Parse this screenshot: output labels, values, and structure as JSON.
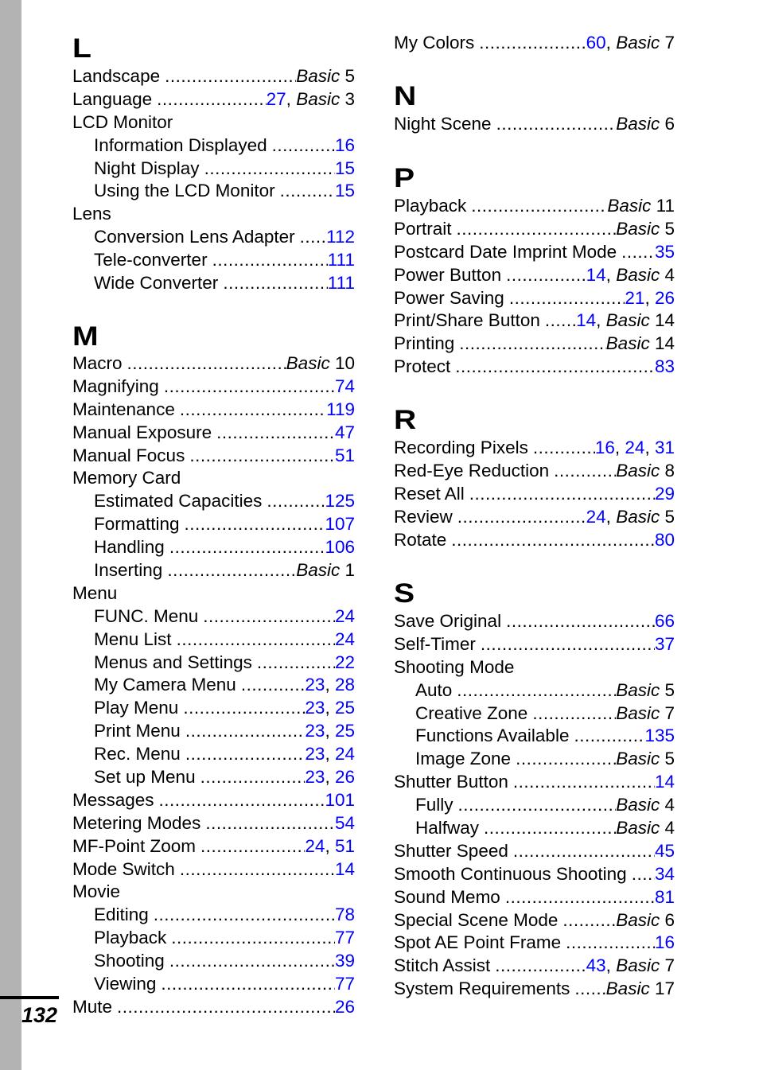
{
  "page_number": "132",
  "colors": {
    "link": "#0000ff",
    "sidebar": "#b3b3b3"
  },
  "columns": [
    {
      "sections": [
        {
          "letter": "L",
          "entries": [
            {
              "term": "Landscape",
              "refs": [
                {
                  "basic": "Basic",
                  "page": "5"
                }
              ]
            },
            {
              "term": "Language",
              "refs": [
                {
                  "link": "27"
                },
                {
                  "basic": "Basic",
                  "page": "3"
                }
              ]
            },
            {
              "term": "LCD Monitor",
              "head": true
            },
            {
              "term": "Information Displayed",
              "sub": true,
              "refs": [
                {
                  "link": "16"
                }
              ]
            },
            {
              "term": "Night Display",
              "sub": true,
              "refs": [
                {
                  "link": "15"
                }
              ]
            },
            {
              "term": "Using the LCD Monitor",
              "sub": true,
              "refs": [
                {
                  "link": "15"
                }
              ]
            },
            {
              "term": "Lens",
              "head": true
            },
            {
              "term": "Conversion Lens Adapter",
              "sub": true,
              "refs": [
                {
                  "link": "112"
                }
              ]
            },
            {
              "term": "Tele-converter",
              "sub": true,
              "refs": [
                {
                  "link": "111"
                }
              ]
            },
            {
              "term": "Wide Converter",
              "sub": true,
              "refs": [
                {
                  "link": "111"
                }
              ]
            }
          ]
        },
        {
          "letter": "M",
          "entries": [
            {
              "term": "Macro",
              "refs": [
                {
                  "basic": "Basic",
                  "page": "10"
                }
              ]
            },
            {
              "term": "Magnifying",
              "refs": [
                {
                  "link": "74"
                }
              ]
            },
            {
              "term": "Maintenance",
              "refs": [
                {
                  "link": "119"
                }
              ]
            },
            {
              "term": "Manual Exposure",
              "refs": [
                {
                  "link": "47"
                }
              ]
            },
            {
              "term": "Manual Focus",
              "refs": [
                {
                  "link": "51"
                }
              ]
            },
            {
              "term": "Memory Card",
              "head": true
            },
            {
              "term": "Estimated Capacities",
              "sub": true,
              "refs": [
                {
                  "link": "125"
                }
              ]
            },
            {
              "term": "Formatting",
              "sub": true,
              "refs": [
                {
                  "link": "107"
                }
              ]
            },
            {
              "term": "Handling",
              "sub": true,
              "refs": [
                {
                  "link": "106"
                }
              ]
            },
            {
              "term": "Inserting",
              "sub": true,
              "refs": [
                {
                  "basic": "Basic",
                  "page": "1"
                }
              ]
            },
            {
              "term": "Menu",
              "head": true
            },
            {
              "term": "FUNC. Menu",
              "sub": true,
              "refs": [
                {
                  "link": "24"
                }
              ]
            },
            {
              "term": "Menu List",
              "sub": true,
              "refs": [
                {
                  "link": "24"
                }
              ]
            },
            {
              "term": "Menus and Settings",
              "sub": true,
              "refs": [
                {
                  "link": "22"
                }
              ]
            },
            {
              "term": "My Camera Menu",
              "sub": true,
              "refs": [
                {
                  "link": "23"
                },
                {
                  "link": "28"
                }
              ]
            },
            {
              "term": "Play Menu",
              "sub": true,
              "refs": [
                {
                  "link": "23"
                },
                {
                  "link": "25"
                }
              ]
            },
            {
              "term": "Print Menu",
              "sub": true,
              "refs": [
                {
                  "link": "23"
                },
                {
                  "link": "25"
                }
              ]
            },
            {
              "term": "Rec. Menu",
              "sub": true,
              "refs": [
                {
                  "link": "23"
                },
                {
                  "link": "24"
                }
              ]
            },
            {
              "term": "Set up Menu",
              "sub": true,
              "refs": [
                {
                  "link": "23"
                },
                {
                  "link": "26"
                }
              ]
            },
            {
              "term": "Messages",
              "refs": [
                {
                  "link": "101"
                }
              ]
            },
            {
              "term": "Metering Modes",
              "refs": [
                {
                  "link": "54"
                }
              ]
            },
            {
              "term": "MF-Point Zoom",
              "refs": [
                {
                  "link": "24"
                },
                {
                  "link": "51"
                }
              ]
            },
            {
              "term": "Mode Switch",
              "refs": [
                {
                  "link": "14"
                }
              ]
            },
            {
              "term": "Movie",
              "head": true
            },
            {
              "term": "Editing",
              "sub": true,
              "refs": [
                {
                  "link": "78"
                }
              ]
            },
            {
              "term": "Playback",
              "sub": true,
              "refs": [
                {
                  "link": "77"
                }
              ]
            },
            {
              "term": "Shooting",
              "sub": true,
              "refs": [
                {
                  "link": "39"
                }
              ]
            },
            {
              "term": "Viewing",
              "sub": true,
              "refs": [
                {
                  "link": "77"
                }
              ]
            },
            {
              "term": "Mute",
              "refs": [
                {
                  "link": "26"
                }
              ]
            }
          ]
        }
      ]
    },
    {
      "sections": [
        {
          "letter": "",
          "entries": [
            {
              "term": "My Colors",
              "refs": [
                {
                  "link": "60"
                },
                {
                  "basic": "Basic",
                  "page": "7"
                }
              ]
            }
          ]
        },
        {
          "letter": "N",
          "entries": [
            {
              "term": "Night Scene",
              "refs": [
                {
                  "basic": "Basic",
                  "page": "6"
                }
              ]
            }
          ]
        },
        {
          "letter": "P",
          "entries": [
            {
              "term": "Playback",
              "refs": [
                {
                  "basic": "Basic",
                  "page": "11"
                }
              ]
            },
            {
              "term": "Portrait",
              "refs": [
                {
                  "basic": "Basic",
                  "page": "5"
                }
              ]
            },
            {
              "term": "Postcard Date Imprint Mode",
              "refs": [
                {
                  "link": "35"
                }
              ]
            },
            {
              "term": "Power Button",
              "refs": [
                {
                  "link": "14"
                },
                {
                  "basic": "Basic",
                  "page": "4"
                }
              ]
            },
            {
              "term": "Power Saving",
              "refs": [
                {
                  "link": "21"
                },
                {
                  "link": "26"
                }
              ]
            },
            {
              "term": "Print/Share Button",
              "refs": [
                {
                  "link": "14"
                },
                {
                  "basic": "Basic",
                  "page": "14"
                }
              ]
            },
            {
              "term": "Printing",
              "refs": [
                {
                  "basic": "Basic",
                  "page": "14"
                }
              ]
            },
            {
              "term": "Protect",
              "refs": [
                {
                  "link": "83"
                }
              ]
            }
          ]
        },
        {
          "letter": "R",
          "entries": [
            {
              "term": "Recording Pixels",
              "refs": [
                {
                  "link": "16"
                },
                {
                  "link": "24"
                },
                {
                  "link": "31"
                }
              ]
            },
            {
              "term": "Red-Eye Reduction",
              "refs": [
                {
                  "basic": "Basic",
                  "page": "8"
                }
              ]
            },
            {
              "term": "Reset All",
              "refs": [
                {
                  "link": "29"
                }
              ]
            },
            {
              "term": "Review",
              "refs": [
                {
                  "link": "24"
                },
                {
                  "basic": "Basic",
                  "page": "5"
                }
              ]
            },
            {
              "term": "Rotate",
              "refs": [
                {
                  "link": "80"
                }
              ]
            }
          ]
        },
        {
          "letter": "S",
          "entries": [
            {
              "term": "Save Original",
              "refs": [
                {
                  "link": "66"
                }
              ]
            },
            {
              "term": "Self-Timer",
              "refs": [
                {
                  "link": "37"
                }
              ]
            },
            {
              "term": "Shooting Mode",
              "head": true
            },
            {
              "term": "Auto",
              "sub": true,
              "refs": [
                {
                  "basic": "Basic",
                  "page": "5"
                }
              ]
            },
            {
              "term": "Creative Zone",
              "sub": true,
              "refs": [
                {
                  "basic": "Basic",
                  "page": "7"
                }
              ]
            },
            {
              "term": "Functions Available",
              "sub": true,
              "refs": [
                {
                  "link": "135"
                }
              ]
            },
            {
              "term": "Image Zone",
              "sub": true,
              "refs": [
                {
                  "basic": "Basic",
                  "page": "5"
                }
              ]
            },
            {
              "term": "Shutter Button",
              "refs": [
                {
                  "link": "14"
                }
              ]
            },
            {
              "term": "Fully",
              "sub": true,
              "refs": [
                {
                  "basic": "Basic",
                  "page": "4"
                }
              ]
            },
            {
              "term": "Halfway",
              "sub": true,
              "refs": [
                {
                  "basic": "Basic",
                  "page": "4"
                }
              ]
            },
            {
              "term": "Shutter Speed",
              "refs": [
                {
                  "link": "45"
                }
              ]
            },
            {
              "term": "Smooth Continuous Shooting",
              "refs": [
                {
                  "link": "34"
                }
              ]
            },
            {
              "term": "Sound Memo",
              "refs": [
                {
                  "link": "81"
                }
              ]
            },
            {
              "term": "Special Scene Mode",
              "refs": [
                {
                  "basic": "Basic",
                  "page": "6"
                }
              ]
            },
            {
              "term": "Spot AE Point Frame",
              "refs": [
                {
                  "link": "16"
                }
              ]
            },
            {
              "term": "Stitch Assist",
              "refs": [
                {
                  "link": "43"
                },
                {
                  "basic": "Basic",
                  "page": "7"
                }
              ]
            },
            {
              "term": "System Requirements",
              "refs": [
                {
                  "basic": "Basic",
                  "page": "17"
                }
              ]
            }
          ]
        }
      ]
    }
  ]
}
